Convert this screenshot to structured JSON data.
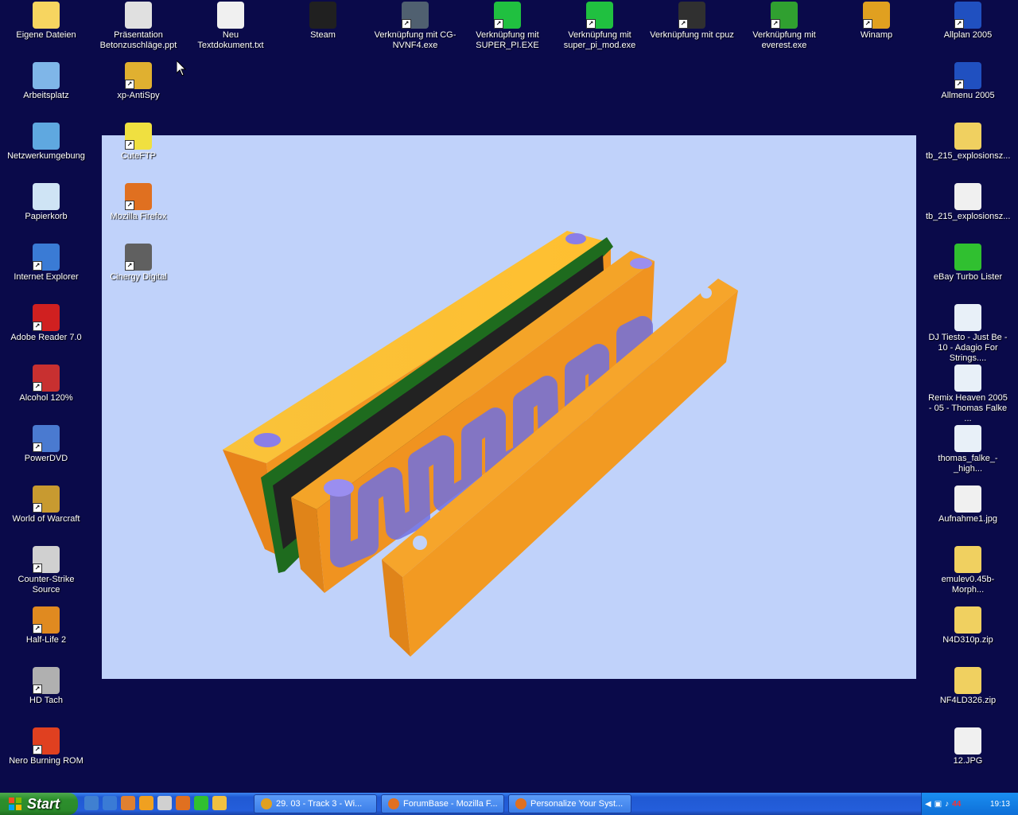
{
  "desktop": {
    "icons_left": [
      {
        "label": "Eigene Dateien",
        "icon": "folder-documents-icon",
        "color": "#f7d560"
      },
      {
        "label": "Arbeitsplatz",
        "icon": "computer-icon",
        "color": "#7fb6e8"
      },
      {
        "label": "Netzwerkumgebung",
        "icon": "network-icon",
        "color": "#5fa8e0"
      },
      {
        "label": "Papierkorb",
        "icon": "recycle-bin-icon",
        "color": "#cfe4f5"
      },
      {
        "label": "Internet Explorer",
        "icon": "internet-explorer-icon",
        "color": "#3a7bd5"
      },
      {
        "label": "Adobe Reader 7.0",
        "icon": "adobe-reader-icon",
        "color": "#d02020"
      },
      {
        "label": "Alcohol 120%",
        "icon": "alcohol-icon",
        "color": "#c83030"
      },
      {
        "label": "PowerDVD",
        "icon": "powerdvd-icon",
        "color": "#4a7ad0"
      },
      {
        "label": "World of Warcraft",
        "icon": "warcraft-icon",
        "color": "#c89a30"
      },
      {
        "label": "Counter-Strike Source",
        "icon": "counter-strike-icon",
        "color": "#d0d0d0"
      },
      {
        "label": "Half-Life 2",
        "icon": "half-life-icon",
        "color": "#e08a20"
      },
      {
        "label": "HD Tach",
        "icon": "hd-tach-icon",
        "color": "#b0b0b0"
      },
      {
        "label": "Nero Burning ROM",
        "icon": "nero-icon",
        "color": "#e04020"
      }
    ],
    "icons_col2": [
      {
        "label": "Präsentation Betonzuschläge.ppt",
        "icon": "powerpoint-icon",
        "color": "#e0e0e0"
      },
      {
        "label": "xp-AntiSpy",
        "icon": "antispy-icon",
        "color": "#e0b030"
      },
      {
        "label": "CuteFTP",
        "icon": "cuteftp-icon",
        "color": "#f0e040"
      },
      {
        "label": "Mozilla Firefox",
        "icon": "firefox-icon",
        "color": "#e07020"
      },
      {
        "label": "Cinergy Digital",
        "icon": "cinergy-icon",
        "color": "#606060"
      }
    ],
    "icons_top": [
      {
        "label": "Neu Textdokument.txt",
        "icon": "text-document-icon",
        "color": "#f0f0f0"
      },
      {
        "label": "Steam",
        "icon": "steam-icon",
        "color": "#202020"
      },
      {
        "label": "Verknüpfung mit CG-NVNF4.exe",
        "icon": "cg-nvnf4-icon",
        "color": "#506070"
      },
      {
        "label": "Verknüpfung mit SUPER_PI.EXE",
        "icon": "super-pi-icon",
        "color": "#20c040"
      },
      {
        "label": "Verknüpfung mit super_pi_mod.exe",
        "icon": "super-pi-mod-icon",
        "color": "#20c040"
      },
      {
        "label": "Verknüpfung mit cpuz",
        "icon": "cpuz-icon",
        "color": "#303030"
      },
      {
        "label": "Verknüpfung mit everest.exe",
        "icon": "everest-icon",
        "color": "#30a030"
      },
      {
        "label": "Winamp",
        "icon": "winamp-icon",
        "color": "#e0a020"
      }
    ],
    "icons_right": [
      {
        "label": "Allplan 2005",
        "icon": "allplan-icon",
        "color": "#2050c0"
      },
      {
        "label": "Allmenu 2005",
        "icon": "allmenu-icon",
        "color": "#2050c0"
      },
      {
        "label": "tb_215_explosionsz...",
        "icon": "zip-folder-icon",
        "color": "#f0d060"
      },
      {
        "label": "tb_215_explosionsz...",
        "icon": "document-icon",
        "color": "#f0f0f0"
      },
      {
        "label": "eBay Turbo Lister",
        "icon": "ebay-turbo-lister-icon",
        "color": "#30c030"
      },
      {
        "label": "DJ Tiesto - Just Be - 10 - Adagio For Strings....",
        "icon": "audio-file-icon",
        "color": "#e8f0f8"
      },
      {
        "label": "Remix Heaven 2005 - 05 - Thomas Falke ...",
        "icon": "audio-file-icon",
        "color": "#e8f0f8"
      },
      {
        "label": "thomas_falke_-_high...",
        "icon": "audio-file-icon",
        "color": "#e8f0f8"
      },
      {
        "label": "Aufnahme1.jpg",
        "icon": "image-file-icon",
        "color": "#f0f0f0"
      },
      {
        "label": "emulev0.45b-Morph...",
        "icon": "zip-folder-icon",
        "color": "#f0d060"
      },
      {
        "label": "N4D310p.zip",
        "icon": "zip-folder-icon",
        "color": "#f0d060"
      },
      {
        "label": "NF4LD326.zip",
        "icon": "zip-folder-icon",
        "color": "#f0d060"
      },
      {
        "label": "12.JPG",
        "icon": "image-file-icon",
        "color": "#f0f0f0"
      }
    ]
  },
  "taskbar": {
    "start_label": "Start",
    "quicklaunch": [
      {
        "icon": "desktop-icon",
        "color": "#4080d0"
      },
      {
        "icon": "internet-explorer-icon",
        "color": "#3a7bd5"
      },
      {
        "icon": "media-icon",
        "color": "#e08030"
      },
      {
        "icon": "media-player-icon",
        "color": "#f0a020"
      },
      {
        "icon": "notepad-icon",
        "color": "#d0d0d0"
      },
      {
        "icon": "firefox-icon",
        "color": "#e07020"
      },
      {
        "icon": "ebay-icon",
        "color": "#30c030"
      },
      {
        "icon": "clock-icon",
        "color": "#f0c040"
      }
    ],
    "tasks": [
      {
        "label": "29. 03 - Track  3 - Wi...",
        "icon": "winamp-icon",
        "color": "#e0a020"
      },
      {
        "label": "ForumBase - Mozilla F...",
        "icon": "firefox-icon",
        "color": "#e07020"
      },
      {
        "label": "Personalize Your Syst...",
        "icon": "firefox-icon",
        "color": "#e07020"
      }
    ],
    "tray_temp": "44",
    "clock": "19:13"
  }
}
